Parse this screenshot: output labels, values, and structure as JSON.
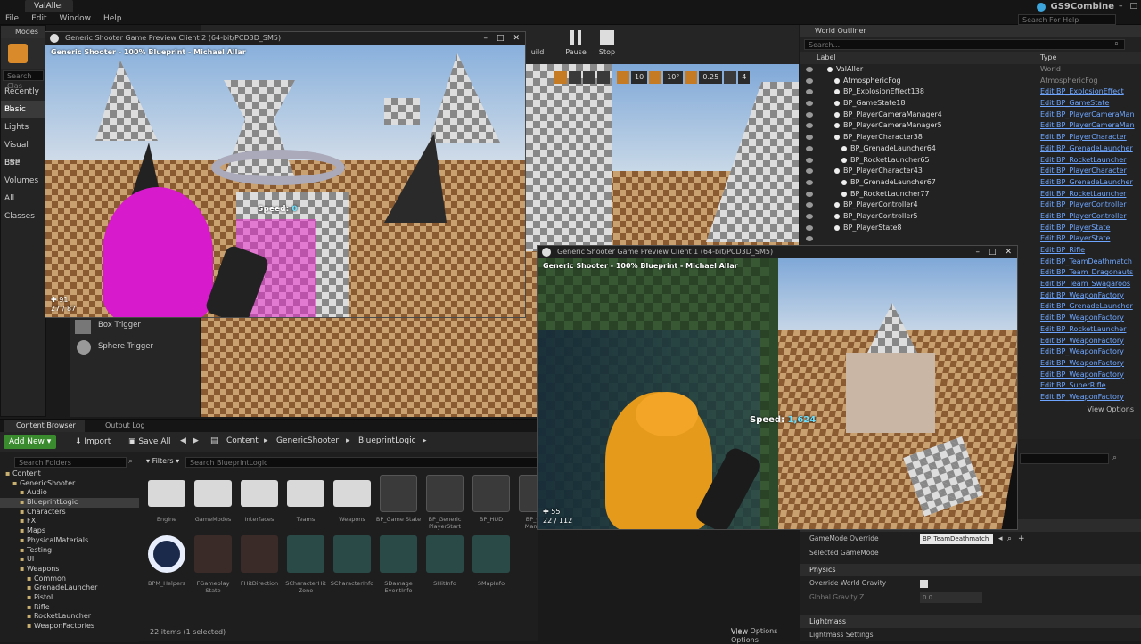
{
  "menubar": {
    "tab_title": "ValAller",
    "menus": [
      "File",
      "Edit",
      "Window",
      "Help"
    ],
    "project_name": "GS9Combine",
    "search_placeholder": "Search For Help"
  },
  "modes": {
    "tab_label": "Modes",
    "search_placeholder": "Search Clas",
    "categories": [
      "Recently Pl",
      "Basic",
      "Lights",
      "Visual Effe",
      "BSP",
      "Volumes",
      "All Classes"
    ],
    "selected_category": "Basic",
    "items": [
      "Box Trigger",
      "Sphere Trigger"
    ]
  },
  "toolbar": {
    "build_label": "uild",
    "pause_label": "Pause",
    "stop_label": "Stop"
  },
  "viewport_controls": {
    "grid_snap": "10",
    "rotation_snap": "10°",
    "scale_snap": "0.25",
    "camera_speed": "4"
  },
  "client2": {
    "window_title": "Generic Shooter Game Preview Client 2 (64-bit/PCD3D_SM5)",
    "overlay": "Generic Shooter - 100% Blueprint - Michael Allar",
    "speed_label": "Speed:",
    "speed_value": "0",
    "health": "91",
    "ammo": "27 / 87"
  },
  "client1": {
    "window_title": "Generic Shooter Game Preview Client 1 (64-bit/PCD3D_SM5)",
    "overlay": "Generic Shooter - 100% Blueprint - Michael Allar",
    "speed_label": "Speed:",
    "speed_value": "1,624",
    "health": "55",
    "ammo": "22 / 112"
  },
  "outliner": {
    "tab_label": "World Outliner",
    "search_placeholder": "Search...",
    "col_label": "Label",
    "col_type": "Type",
    "view_options": "View Options",
    "rows": [
      {
        "label": "ValAller",
        "type": "World",
        "link": false,
        "indent": 0
      },
      {
        "label": "AtmosphericFog",
        "type": "AtmosphericFog",
        "link": false,
        "indent": 1
      },
      {
        "label": "BP_ExplosionEffect138",
        "type": "Edit BP_ExplosionEffect",
        "link": true,
        "indent": 1
      },
      {
        "label": "BP_GameState18",
        "type": "Edit BP_GameState",
        "link": true,
        "indent": 1
      },
      {
        "label": "BP_PlayerCameraManager4",
        "type": "Edit BP_PlayerCameraMan",
        "link": true,
        "indent": 1
      },
      {
        "label": "BP_PlayerCameraManager5",
        "type": "Edit BP_PlayerCameraMan",
        "link": true,
        "indent": 1
      },
      {
        "label": "BP_PlayerCharacter38",
        "type": "Edit BP_PlayerCharacter",
        "link": true,
        "indent": 1
      },
      {
        "label": "BP_GrenadeLauncher64",
        "type": "Edit BP_GrenadeLauncher",
        "link": true,
        "indent": 2
      },
      {
        "label": "BP_RocketLauncher65",
        "type": "Edit BP_RocketLauncher",
        "link": true,
        "indent": 2
      },
      {
        "label": "BP_PlayerCharacter43",
        "type": "Edit BP_PlayerCharacter",
        "link": true,
        "indent": 1
      },
      {
        "label": "BP_GrenadeLauncher67",
        "type": "Edit BP_GrenadeLauncher",
        "link": true,
        "indent": 2
      },
      {
        "label": "BP_RocketLauncher77",
        "type": "Edit BP_RocketLauncher",
        "link": true,
        "indent": 2
      },
      {
        "label": "BP_PlayerController4",
        "type": "Edit BP_PlayerController",
        "link": true,
        "indent": 1
      },
      {
        "label": "BP_PlayerController5",
        "type": "Edit BP_PlayerController",
        "link": true,
        "indent": 1
      },
      {
        "label": "BP_PlayerState8",
        "type": "Edit BP_PlayerState",
        "link": true,
        "indent": 1
      },
      {
        "label": "",
        "type": "Edit BP_PlayerState",
        "link": true,
        "indent": 1
      },
      {
        "label": "",
        "type": "Edit BP_Rifle",
        "link": true,
        "indent": 1
      },
      {
        "label": "",
        "type": "Edit BP_TeamDeathmatch",
        "link": true,
        "indent": 1
      },
      {
        "label": "",
        "type": "Edit BP_Team_Dragonauts",
        "link": true,
        "indent": 1
      },
      {
        "label": "",
        "type": "Edit BP_Team_Swagaroos",
        "link": true,
        "indent": 1
      },
      {
        "label": "",
        "type": "Edit BP_WeaponFactory",
        "link": true,
        "indent": 1
      },
      {
        "label": "",
        "type": "Edit BP_GrenadeLauncher",
        "link": true,
        "indent": 1
      },
      {
        "label": "",
        "type": "Edit BP_WeaponFactory",
        "link": true,
        "indent": 1
      },
      {
        "label": "",
        "type": "Edit BP_RocketLauncher",
        "link": true,
        "indent": 1
      },
      {
        "label": "",
        "type": "Edit BP_WeaponFactory",
        "link": true,
        "indent": 1
      },
      {
        "label": "",
        "type": "Edit BP_WeaponFactory",
        "link": true,
        "indent": 1
      },
      {
        "label": "",
        "type": "Edit BP_WeaponFactory",
        "link": true,
        "indent": 1
      },
      {
        "label": "",
        "type": "Edit BP_WeaponFactory",
        "link": true,
        "indent": 1
      },
      {
        "label": "",
        "type": "Edit BP_SuperRifle",
        "link": true,
        "indent": 1
      },
      {
        "label": "",
        "type": "Edit BP_WeaponFactory",
        "link": true,
        "indent": 1
      }
    ]
  },
  "details": {
    "section_gamemode": "Game Mode",
    "gamemode_override_label": "GameMode Override",
    "gamemode_override_value": "BP_TeamDeathmatch",
    "selected_gamemode_label": "Selected GameMode",
    "section_physics": "Physics",
    "override_gravity_label": "Override World Gravity",
    "global_gravity_label": "Global Gravity Z",
    "global_gravity_value": "0.0",
    "section_lightmass": "Lightmass",
    "lightmass_settings_label": "Lightmass Settings"
  },
  "content_browser": {
    "tab_label": "Content Browser",
    "output_tab_label": "Output Log",
    "add_new": "Add New",
    "import": "Import",
    "save_all": "Save All",
    "breadcrumb": [
      "Content",
      "GenericShooter",
      "BlueprintLogic"
    ],
    "search_folders_placeholder": "Search Folders",
    "filters_label": "Filters",
    "search_assets_placeholder": "Search BlueprintLogic",
    "item_count": "22 items (1 selected)",
    "view_options": "View Options",
    "tree": [
      {
        "label": "Content",
        "indent": 0
      },
      {
        "label": "GenericShooter",
        "indent": 1
      },
      {
        "label": "Audio",
        "indent": 2
      },
      {
        "label": "BlueprintLogic",
        "indent": 2
      },
      {
        "label": "Characters",
        "indent": 2
      },
      {
        "label": "FX",
        "indent": 2
      },
      {
        "label": "Maps",
        "indent": 2
      },
      {
        "label": "PhysicalMaterials",
        "indent": 2
      },
      {
        "label": "Testing",
        "indent": 2
      },
      {
        "label": "UI",
        "indent": 2
      },
      {
        "label": "Weapons",
        "indent": 2
      },
      {
        "label": "Common",
        "indent": 3
      },
      {
        "label": "GrenadeLauncher",
        "indent": 3
      },
      {
        "label": "Pistol",
        "indent": 3
      },
      {
        "label": "Rifle",
        "indent": 3
      },
      {
        "label": "RocketLauncher",
        "indent": 3
      },
      {
        "label": "WeaponFactories",
        "indent": 3
      }
    ],
    "assets_row1": [
      "Engine",
      "GameModes",
      "Interfaces",
      "Teams",
      "Weapons",
      "BP_Game State",
      "BP_Generic PlayerStart",
      "BP_HUD",
      "BP_Cam Manager"
    ],
    "assets_row2": [
      "BPM_Helpers",
      "FGameplay State",
      "FHitDirection",
      "SCharacterHit Zone",
      "SCharacterInfo",
      "SDamage EventInfo",
      "SHitInfo",
      "SMapInfo"
    ]
  }
}
